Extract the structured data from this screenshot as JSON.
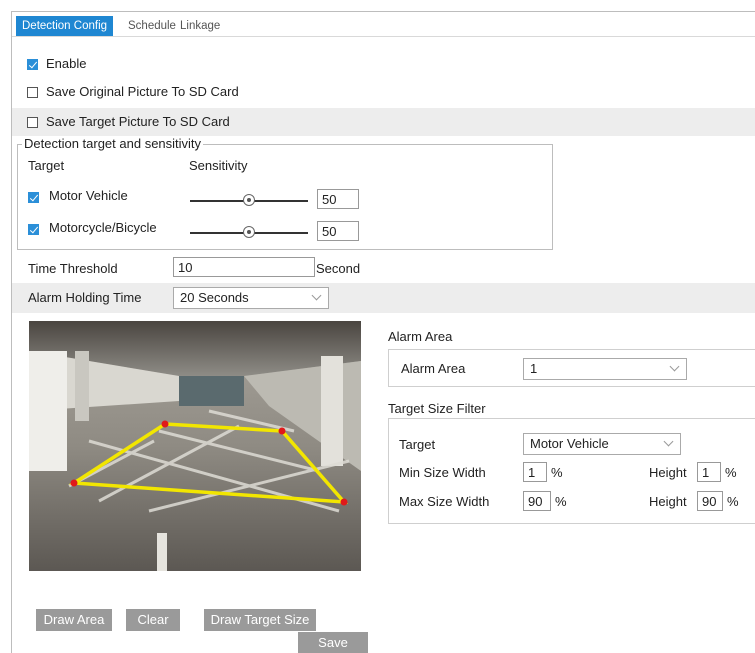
{
  "tabs": [
    {
      "label": "Detection Config",
      "active": true
    },
    {
      "label": "Schedule",
      "active": false
    },
    {
      "label": "Linkage",
      "active": false
    }
  ],
  "enable": {
    "label": "Enable",
    "checked": true
  },
  "save_original": {
    "label": "Save Original Picture To SD Card",
    "checked": false
  },
  "save_target": {
    "label": "Save Target Picture To SD Card",
    "checked": false
  },
  "detection": {
    "legend": "Detection target and sensitivity",
    "col_target": "Target",
    "col_sensitivity": "Sensitivity",
    "items": [
      {
        "label": "Motor Vehicle",
        "checked": true,
        "value": "50"
      },
      {
        "label": "Motorcycle/Bicycle",
        "checked": true,
        "value": "50"
      }
    ]
  },
  "time_threshold": {
    "label": "Time Threshold",
    "value": "10",
    "unit": "Second"
  },
  "alarm_holding": {
    "label": "Alarm Holding Time",
    "value": "20 Seconds"
  },
  "alarm_area": {
    "section": "Alarm Area",
    "label": "Alarm Area",
    "value": "1"
  },
  "target_filter": {
    "section": "Target Size Filter",
    "target_label": "Target",
    "target_value": "Motor Vehicle",
    "min_label": "Min Size Width",
    "min_width": "1",
    "min_height": "1",
    "max_label": "Max Size Width",
    "max_width": "90",
    "max_height": "90",
    "height_label": "Height",
    "percent": "%"
  },
  "buttons": {
    "draw_area": "Draw Area",
    "clear": "Clear",
    "draw_target_size": "Draw Target Size",
    "save": "Save"
  },
  "colors": {
    "accent": "#1f87d2",
    "checkbox": "#2b8fd8",
    "button": "#9a9a9a",
    "zone": "#f2e600",
    "zone_corner": "#e0191a"
  }
}
